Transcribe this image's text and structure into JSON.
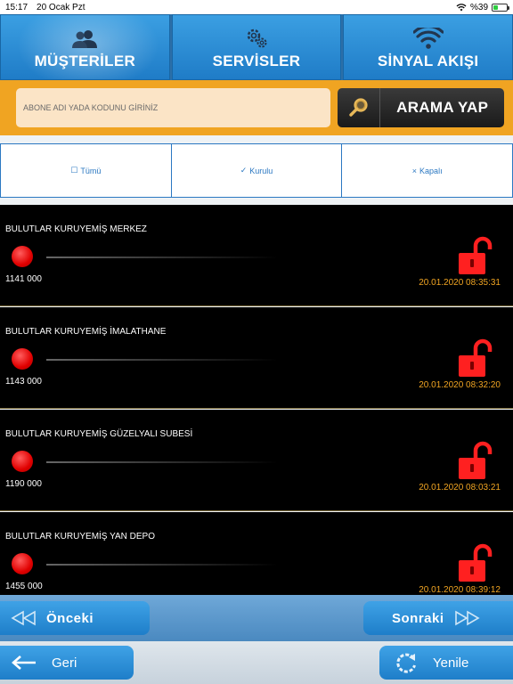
{
  "status_bar": {
    "time": "15:17",
    "date": "20 Ocak Pzt",
    "battery": "%39",
    "battery_level": 0.39,
    "wifi_icon": "wifi-icon"
  },
  "top_nav": {
    "tabs": [
      {
        "label": "MÜŞTERİLER",
        "icon": "users-icon",
        "active": true
      },
      {
        "label": "SERVİSLER",
        "icon": "gears-icon",
        "active": false
      },
      {
        "label": "SİNYAL AKIŞI",
        "icon": "wifi-icon",
        "active": false
      }
    ]
  },
  "search": {
    "placeholder": "ABONE ADI YADA KODUNU GİRİNİZ",
    "value": "",
    "button_label": "ARAMA YAP"
  },
  "filters": [
    {
      "symbol": "☐",
      "label": "Tümü"
    },
    {
      "symbol": "✓",
      "label": "Kurulu"
    },
    {
      "symbol": "×",
      "label": "Kapalı"
    }
  ],
  "subscribers": [
    {
      "name": "BULUTLAR KURUYEMİŞ MERKEZ",
      "code": "1141 000",
      "timestamp": "20.01.2020 08:35:31"
    },
    {
      "name": "BULUTLAR KURUYEMİŞ İMALATHANE",
      "code": "1143 000",
      "timestamp": "20.01.2020 08:32:20"
    },
    {
      "name": "BULUTLAR KURUYEMİŞ GÜZELYALI SUBESİ",
      "code": "1190 000",
      "timestamp": "20.01.2020 08:03:21"
    },
    {
      "name": "BULUTLAR KURUYEMİŞ YAN DEPO",
      "code": "1455 000",
      "timestamp": "20.01.2020 08:39:12"
    }
  ],
  "pager": {
    "prev_label": "Önceki",
    "next_label": "Sonraki"
  },
  "bottom": {
    "back_label": "Geri",
    "refresh_label": "Yenile"
  },
  "colors": {
    "accent": "#f0a422",
    "primary": "#1f7cc7",
    "status_red": "#e00000",
    "lock_red": "#ff2020"
  }
}
